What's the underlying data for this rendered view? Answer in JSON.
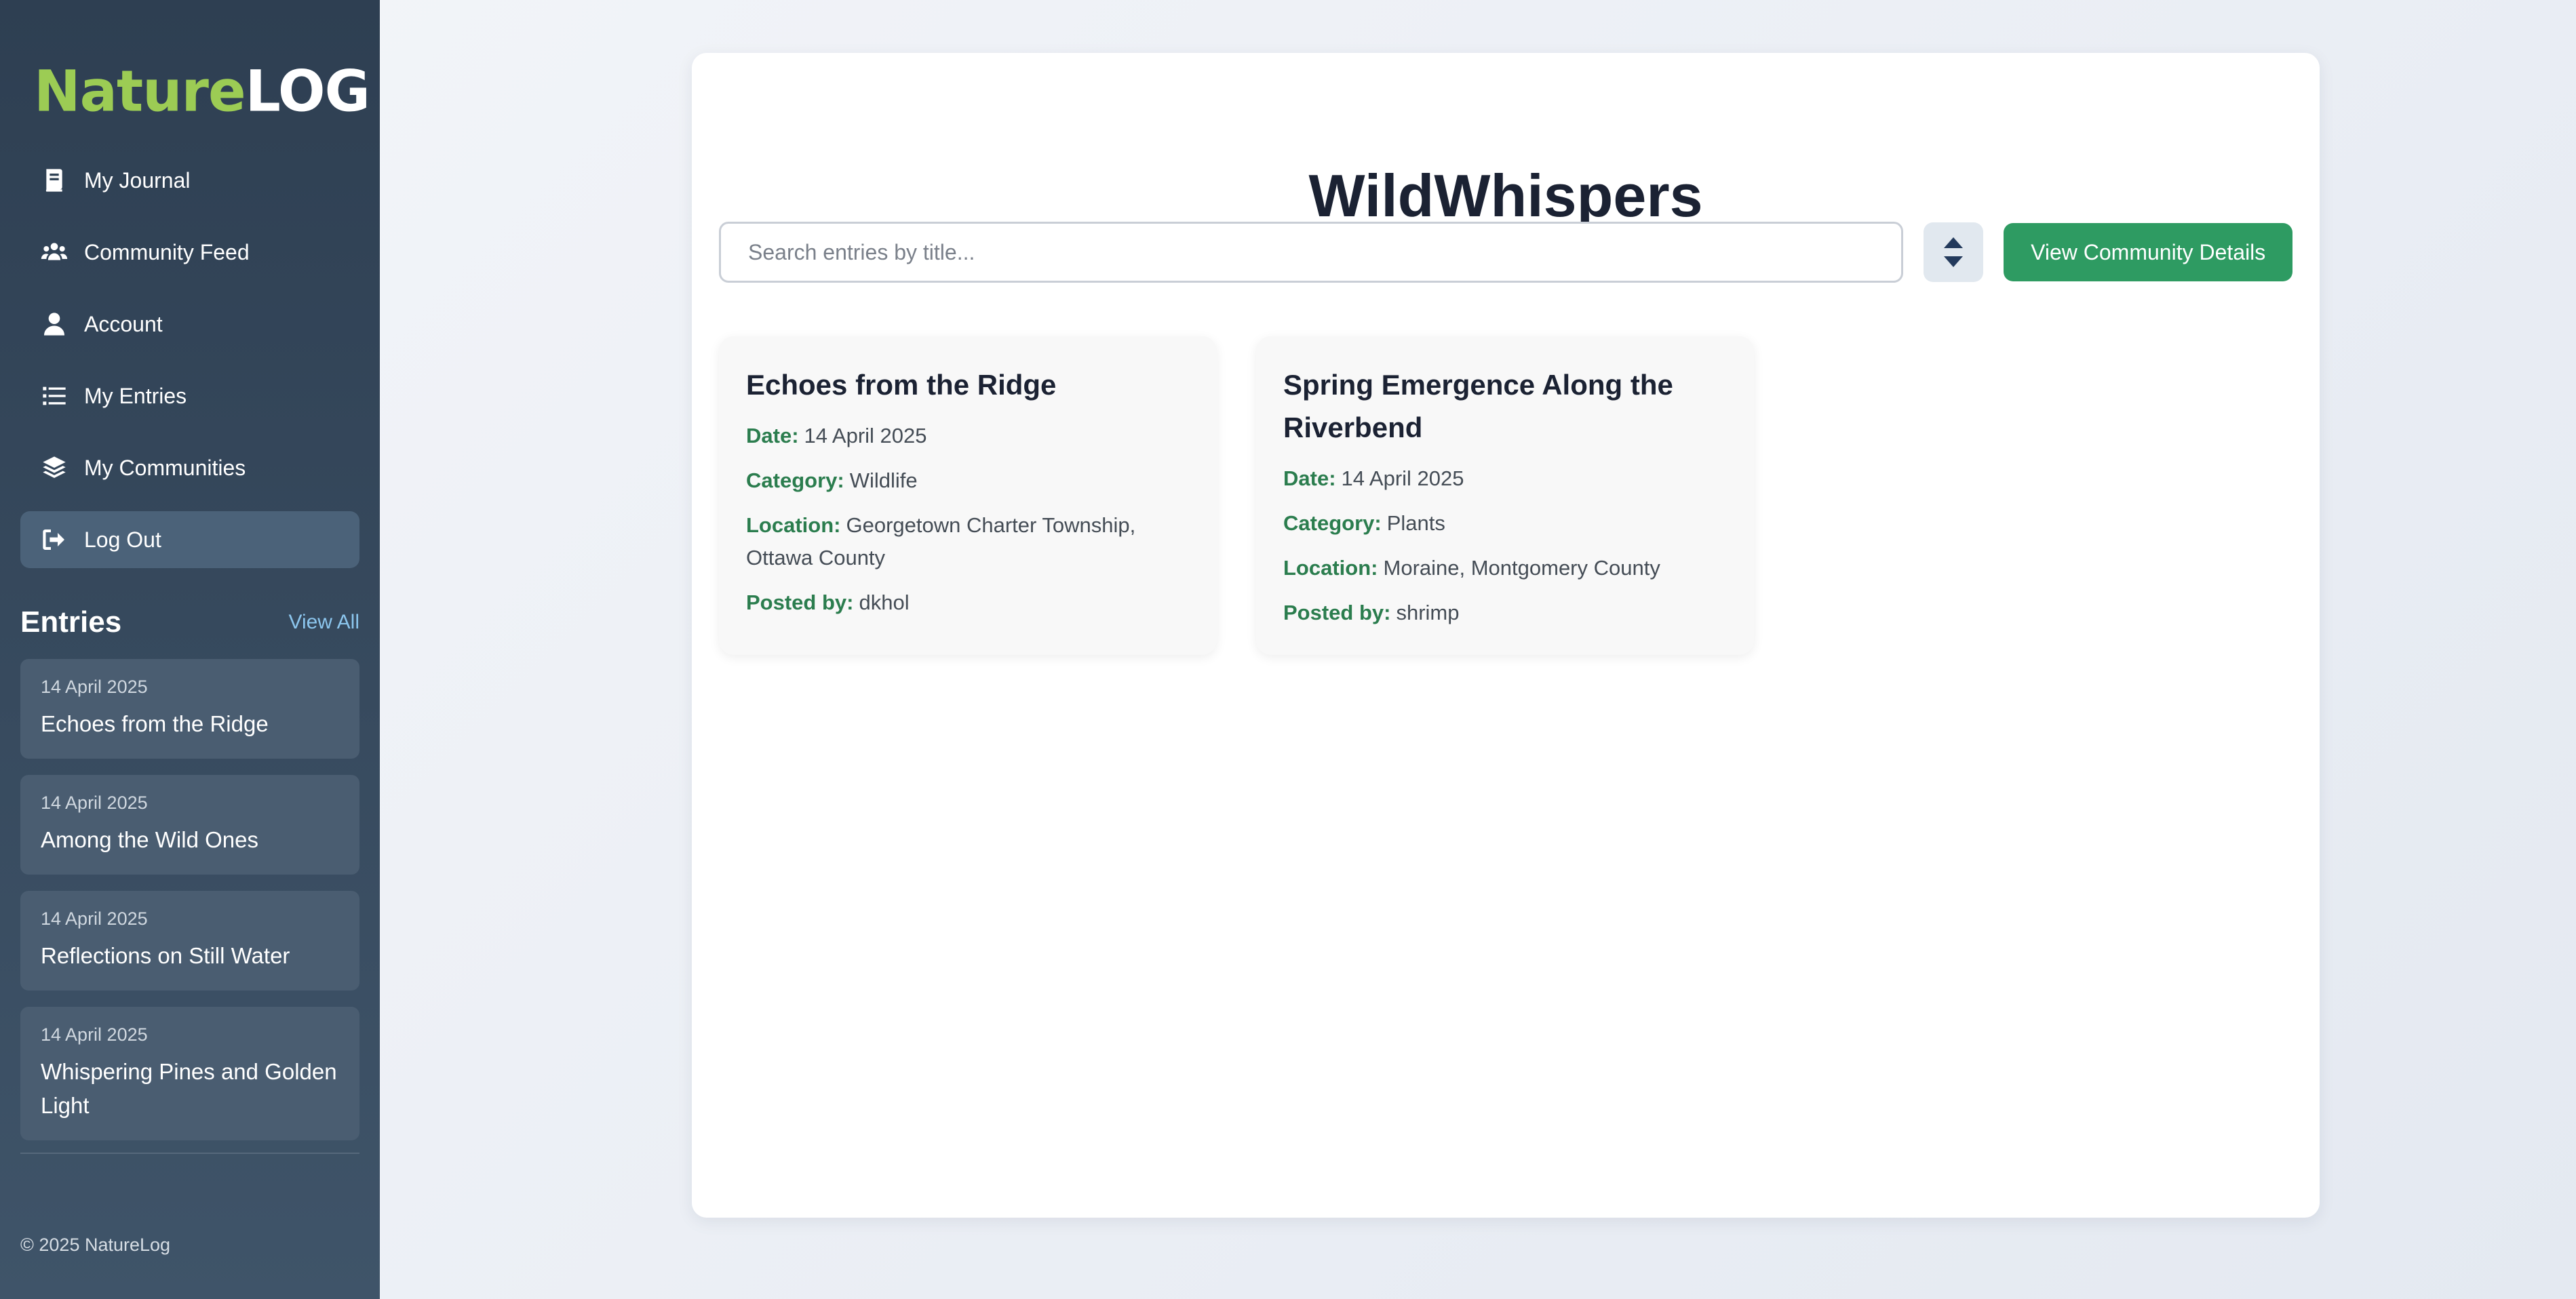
{
  "logo": {
    "part1": "Nature",
    "part2": "LOG"
  },
  "nav": [
    {
      "label": "My Journal",
      "icon": "journal-icon"
    },
    {
      "label": "Community Feed",
      "icon": "users-icon"
    },
    {
      "label": "Account",
      "icon": "user-icon"
    },
    {
      "label": "My Entries",
      "icon": "list-icon"
    },
    {
      "label": "My Communities",
      "icon": "layers-icon"
    },
    {
      "label": "Log Out",
      "icon": "logout-icon",
      "active": true
    }
  ],
  "sidebar_entries": {
    "title": "Entries",
    "view_all": "View All",
    "items": [
      {
        "date": "14 April 2025",
        "title": "Echoes from the Ridge"
      },
      {
        "date": "14 April 2025",
        "title": "Among the Wild Ones"
      },
      {
        "date": "14 April 2025",
        "title": "Reflections on Still Water"
      },
      {
        "date": "14 April 2025",
        "title": "Whispering Pines and Golden Light"
      }
    ]
  },
  "footer": {
    "copyright": "© 2025 NatureLog"
  },
  "main": {
    "title": "WildWhispers",
    "search_placeholder": "Search entries by title...",
    "sort_icon": "sort-icon",
    "community_button": "View Community Details",
    "labels": {
      "date": "Date:",
      "category": "Category:",
      "location": "Location:",
      "posted_by": "Posted by:"
    },
    "cards": [
      {
        "title": "Echoes from the Ridge",
        "date": "14 April 2025",
        "category": "Wildlife",
        "location": "Georgetown Charter Township, Ottawa County",
        "posted_by": "dkhol"
      },
      {
        "title": "Spring Emergence Along the Riverbend",
        "date": "14 April 2025",
        "category": "Plants",
        "location": "Moraine, Montgomery County",
        "posted_by": "shrimp"
      }
    ]
  },
  "colors": {
    "accent_green": "#2e9b62",
    "logo_green": "#9ccc54",
    "label_green": "#2b7d4e",
    "sidebar_bg": "#2e3f52"
  }
}
